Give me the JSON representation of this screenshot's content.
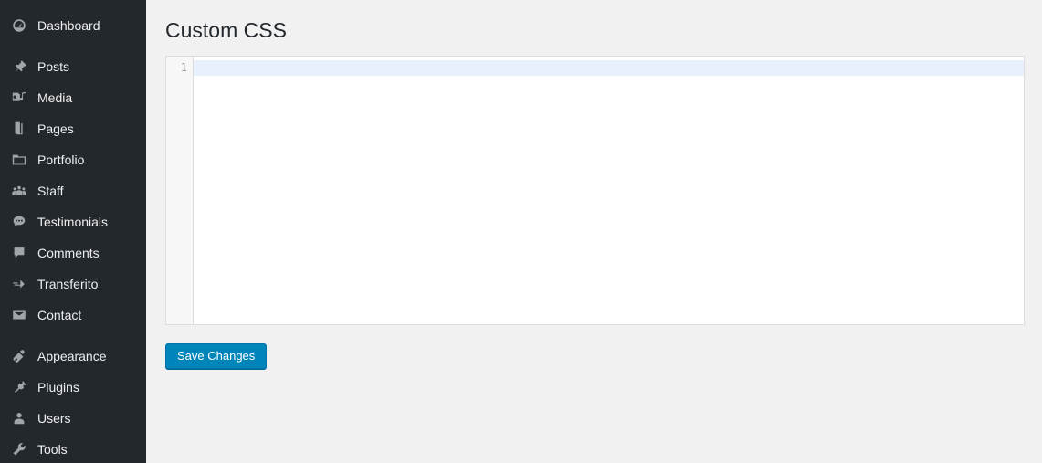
{
  "sidebar": {
    "items": [
      {
        "label": "Dashboard",
        "icon": "dashboard-gauge-icon"
      },
      {
        "separator": true
      },
      {
        "label": "Posts",
        "icon": "pushpin-icon"
      },
      {
        "label": "Media",
        "icon": "media-camera-music-icon"
      },
      {
        "label": "Pages",
        "icon": "pages-documents-icon"
      },
      {
        "label": "Portfolio",
        "icon": "portfolio-folder-icon"
      },
      {
        "label": "Staff",
        "icon": "staff-group-icon"
      },
      {
        "label": "Testimonials",
        "icon": "testimonials-speech-bubble-icon"
      },
      {
        "label": "Comments",
        "icon": "comments-bubble-icon"
      },
      {
        "label": "Transferito",
        "icon": "transferito-arrow-icon"
      },
      {
        "label": "Contact",
        "icon": "contact-envelope-icon"
      },
      {
        "separator": true
      },
      {
        "label": "Appearance",
        "icon": "appearance-paintbrush-icon"
      },
      {
        "label": "Plugins",
        "icon": "plugins-plug-icon"
      },
      {
        "label": "Users",
        "icon": "users-person-icon"
      },
      {
        "label": "Tools",
        "icon": "tools-wrench-icon"
      }
    ]
  },
  "main": {
    "page_title": "Custom CSS",
    "editor": {
      "line_numbers": [
        "1"
      ],
      "content": "",
      "active_line": 1
    },
    "save_button_label": "Save Changes"
  },
  "colors": {
    "sidebar_bg": "#23282d",
    "content_bg": "#f1f1f1",
    "editor_bg": "#ffffff",
    "active_line": "#e8f0fe",
    "gutter_bg": "#f7f7f7",
    "button_primary": "#0085ba",
    "title_text": "#23282d"
  }
}
